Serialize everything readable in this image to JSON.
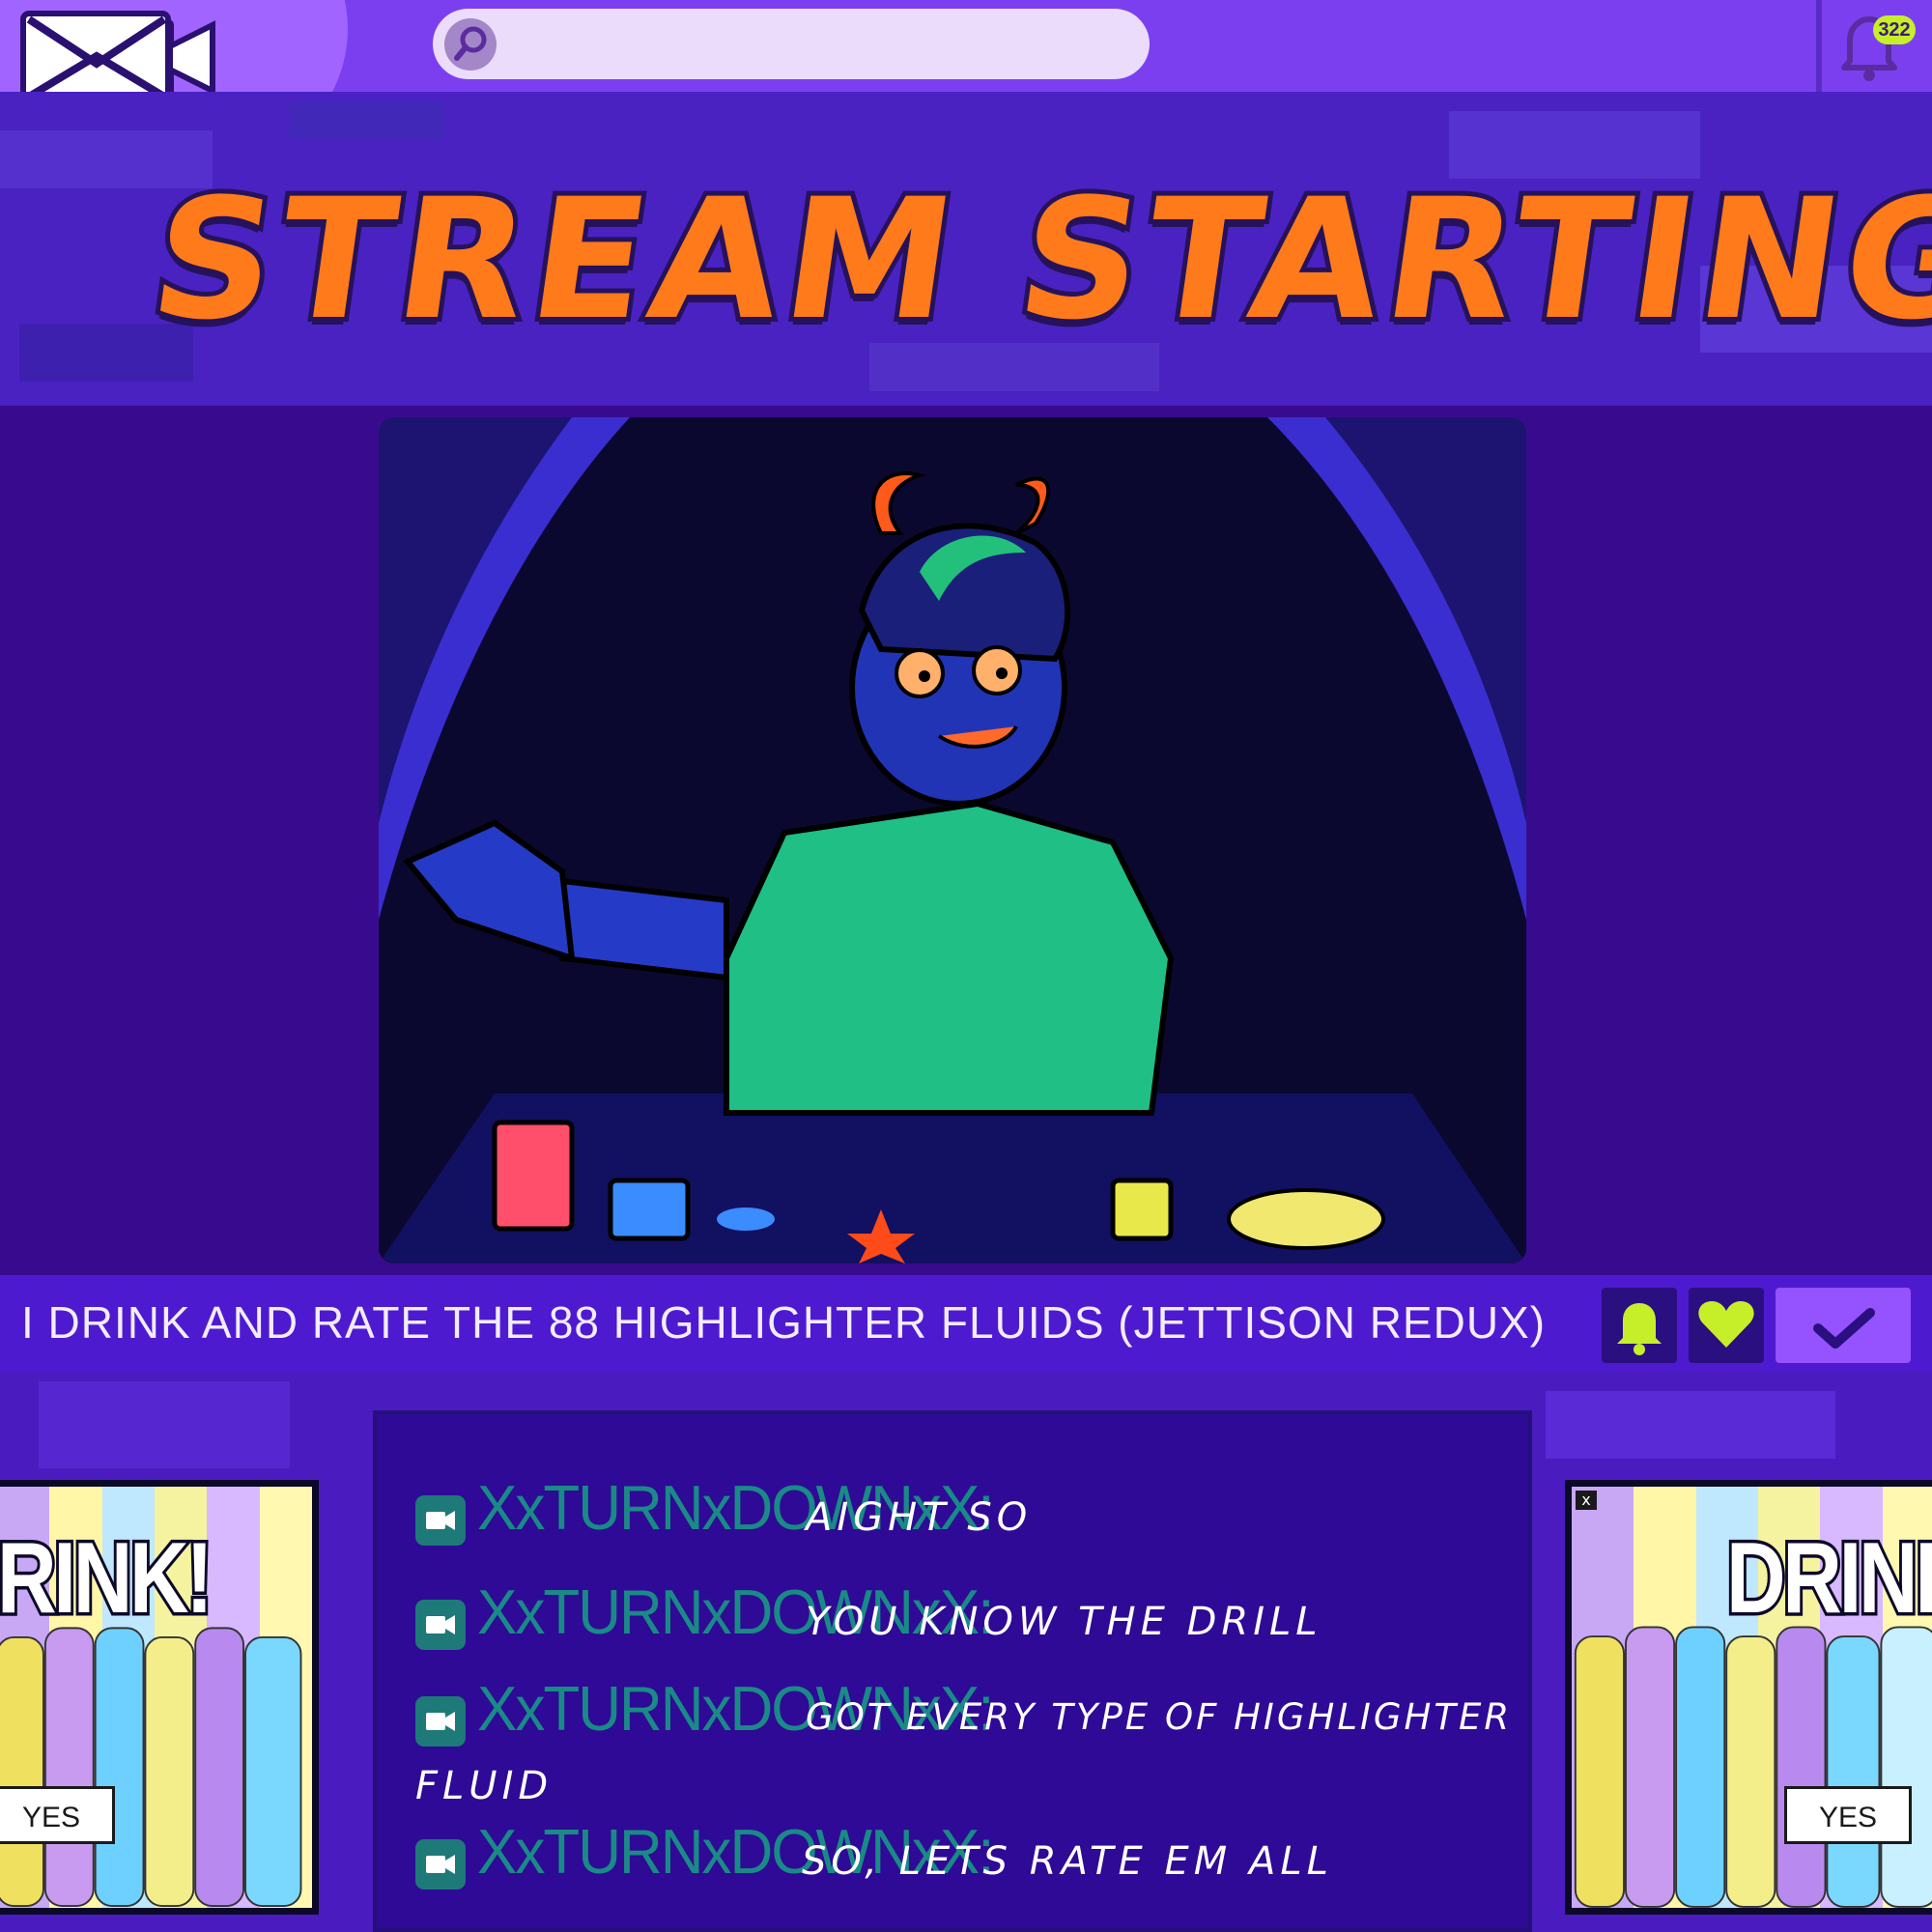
{
  "header": {
    "search_placeholder": "",
    "notification_count": "322"
  },
  "banner": {
    "title": "STREAM STARTING..."
  },
  "stream": {
    "title": "I DRINK AND RATE THE 88 HIGHLIGHTER FLUIDS (JETTISON REDUX)"
  },
  "chat": {
    "messages": [
      {
        "user": "XxTURNxDOWNxX:",
        "text": "AIGHT SO"
      },
      {
        "user": "XxTURNxDOWNxX:",
        "text": "YOU KNOW THE DRILL"
      },
      {
        "user": "XxTURNxDOWNxX:",
        "text": "GOT EVERY TYPE OF HIGHLIGHTER",
        "text2": "FLUID"
      },
      {
        "user": "XxTURNxDOWNxX:",
        "text": "SO, LETS RATE EM ALL"
      }
    ]
  },
  "ads": {
    "left": {
      "headline": "RINK!",
      "button": "YES"
    },
    "right": {
      "headline": "DRINK",
      "button": "YES",
      "close": "x"
    }
  },
  "colors": {
    "topbar": "#7b3ff0",
    "accent_green": "#c6ef2a",
    "chat_user": "#1a8a86",
    "title_orange": "#ff7a1a"
  },
  "icons": {
    "logo": "camera-logo-icon",
    "search": "search-icon",
    "bell": "bell-icon",
    "notify": "bell-icon",
    "like": "heart-icon",
    "follow": "checkmark-icon",
    "chat": "camera-icon"
  }
}
